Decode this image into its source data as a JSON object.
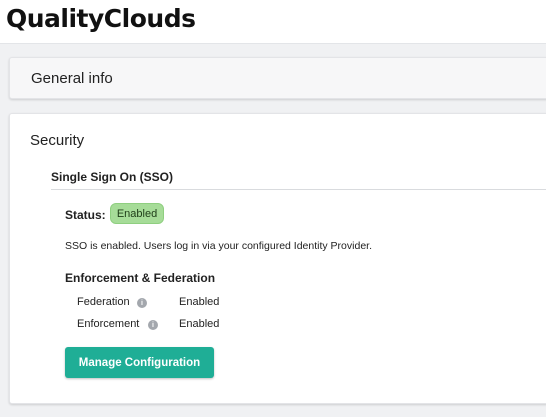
{
  "header": {
    "logo_text": "QualityClouds"
  },
  "general_info": {
    "title": "General info"
  },
  "security": {
    "title": "Security",
    "sso": {
      "heading": "Single Sign On (SSO)",
      "status_label": "Status:",
      "status_value": "Enabled",
      "status_color": "#a6dc98",
      "description": "SSO is enabled. Users log in via your configured Identity Provider.",
      "enforcement_heading": "Enforcement & Federation",
      "rows": [
        {
          "label": "Federation",
          "icon": "info-icon",
          "value": "Enabled"
        },
        {
          "label": "Enforcement",
          "icon": "info-icon",
          "value": "Enabled"
        }
      ],
      "manage_button": "Manage Configuration",
      "button_color": "#1fae96"
    }
  }
}
